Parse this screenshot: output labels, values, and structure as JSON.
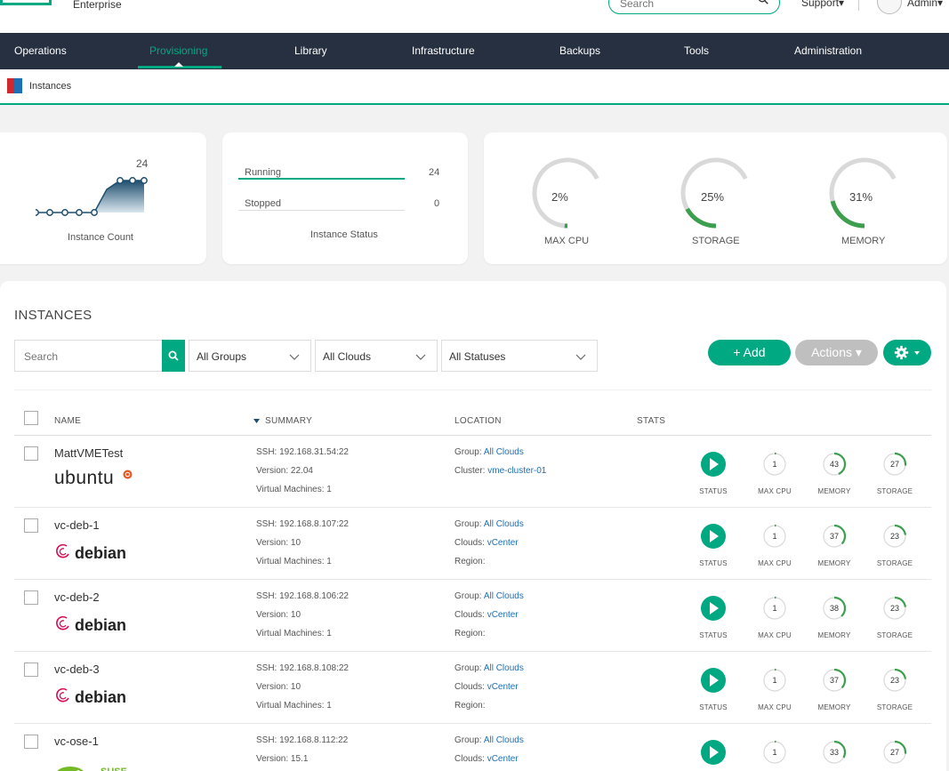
{
  "header": {
    "brand_text": "Enterprise",
    "search_placeholder": "Search",
    "support_label": "Support▾",
    "admin_label": "Admin▾"
  },
  "nav": {
    "items": [
      "Operations",
      "Provisioning",
      "Library",
      "Infrastructure",
      "Backups",
      "Tools",
      "Administration"
    ],
    "active": "Provisioning"
  },
  "breadcrumb": {
    "label": "Instances"
  },
  "cards": {
    "count": {
      "value": "24",
      "label": "Instance Count",
      "sparkline": [
        0,
        0,
        0,
        0,
        22,
        24,
        24
      ]
    },
    "status": {
      "running_label": "Running",
      "running_value": "24",
      "stopped_label": "Stopped",
      "stopped_value": "0",
      "label": "Instance Status"
    },
    "gauges": [
      {
        "value": "2%",
        "percent": 2,
        "label": "MAX CPU"
      },
      {
        "value": "25%",
        "percent": 25,
        "label": "STORAGE"
      },
      {
        "value": "31%",
        "percent": 31,
        "label": "MEMORY"
      }
    ]
  },
  "instances": {
    "title": "INSTANCES",
    "search_placeholder": "Search",
    "filters": [
      "All Groups",
      "All Clouds",
      "All Statuses"
    ],
    "add_label": "+ Add",
    "actions_label": "Actions ▾",
    "columns": {
      "name": "NAME",
      "summary": "SUMMARY",
      "location": "LOCATION",
      "stats": "STATS"
    },
    "stat_labels": [
      "STATUS",
      "MAX CPU",
      "MEMORY",
      "STORAGE"
    ],
    "rows": [
      {
        "name": "MattVMETest",
        "os": "ubuntu",
        "ssh": "SSH: 192.168.31.54:22",
        "version": "Version: 22.04",
        "vms": "Virtual Machines: 1",
        "loc1_label": "Group: ",
        "loc1_link": "All Clouds",
        "loc2_label": "Cluster: ",
        "loc2_link": "vme-cluster-01",
        "loc3_label": "",
        "cpu": "1",
        "cpu_pct": 1,
        "memory": "43",
        "memory_pct": 43,
        "storage": "27",
        "storage_pct": 27
      },
      {
        "name": "vc-deb-1",
        "os": "debian",
        "ssh": "SSH: 192.168.8.107:22",
        "version": "Version: 10",
        "vms": "Virtual Machines: 1",
        "loc1_label": "Group: ",
        "loc1_link": "All Clouds",
        "loc2_label": "Clouds: ",
        "loc2_link": "vCenter",
        "loc3_label": "Region:",
        "cpu": "1",
        "cpu_pct": 1,
        "memory": "37",
        "memory_pct": 37,
        "storage": "23",
        "storage_pct": 23
      },
      {
        "name": "vc-deb-2",
        "os": "debian",
        "ssh": "SSH: 192.168.8.106:22",
        "version": "Version: 10",
        "vms": "Virtual Machines: 1",
        "loc1_label": "Group: ",
        "loc1_link": "All Clouds",
        "loc2_label": "Clouds: ",
        "loc2_link": "vCenter",
        "loc3_label": "Region:",
        "cpu": "1",
        "cpu_pct": 1,
        "memory": "38",
        "memory_pct": 38,
        "storage": "23",
        "storage_pct": 23
      },
      {
        "name": "vc-deb-3",
        "os": "debian",
        "ssh": "SSH: 192.168.8.108:22",
        "version": "Version: 10",
        "vms": "Virtual Machines: 1",
        "loc1_label": "Group: ",
        "loc1_link": "All Clouds",
        "loc2_label": "Clouds: ",
        "loc2_link": "vCenter",
        "loc3_label": "Region:",
        "cpu": "1",
        "cpu_pct": 1,
        "memory": "37",
        "memory_pct": 37,
        "storage": "23",
        "storage_pct": 23
      },
      {
        "name": "vc-ose-1",
        "os": "opensuse",
        "ssh": "SSH: 192.168.8.112:22",
        "version": "Version: 15.1",
        "vms": "",
        "loc1_label": "Group: ",
        "loc1_link": "All Clouds",
        "loc2_label": "Clouds: ",
        "loc2_link": "vCenter",
        "loc3_label": "",
        "cpu": "1",
        "cpu_pct": 1,
        "memory": "33",
        "memory_pct": 33,
        "storage": "27",
        "storage_pct": 27
      }
    ],
    "logo_text": {
      "ubuntu": "ubuntu",
      "debian": "debian",
      "opensuse": "SUSE",
      "opensuse_small": "open"
    }
  },
  "colors": {
    "accent": "#01a982",
    "nav_bg": "#263040",
    "link": "#1d6fb6",
    "gauge_track": "#d9d9d9",
    "gauge_fill": "#3c9f4e"
  }
}
